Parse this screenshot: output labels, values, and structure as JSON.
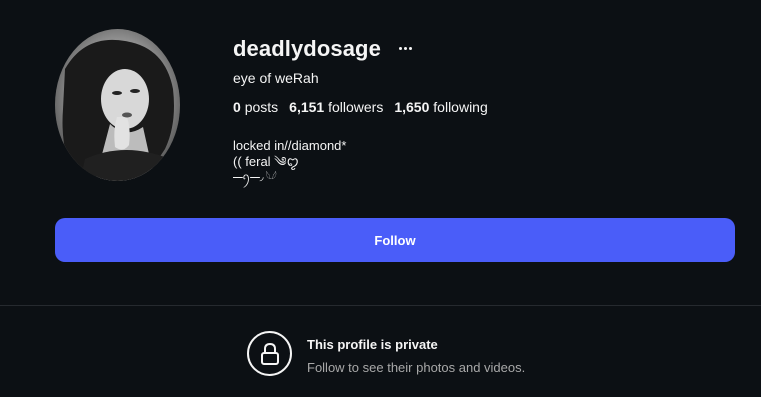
{
  "profile": {
    "username": "deadlydosage",
    "full_name": "eye of weRah",
    "stats": [
      {
        "value": "0",
        "label": "posts"
      },
      {
        "value": "6,151",
        "label": "followers"
      },
      {
        "value": "1,650",
        "label": "following"
      }
    ],
    "bio": {
      "line1": "locked in//diamond*",
      "line2": "(( feral ༄ꨄ︎",
      "line3": "⎯⎯ꪆ⎯⎯◞ 𓆩𓆪"
    }
  },
  "actions": {
    "follow_label": "Follow",
    "more_icon": "more-horizontal-icon"
  },
  "private_notice": {
    "title": "This profile is private",
    "subtitle": "Follow to see their photos and videos.",
    "icon": "lock-icon"
  },
  "colors": {
    "background": "#0c1014",
    "accent": "#4a5df9",
    "text_primary": "#f5f5f5",
    "text_secondary": "#a8a8a8"
  }
}
